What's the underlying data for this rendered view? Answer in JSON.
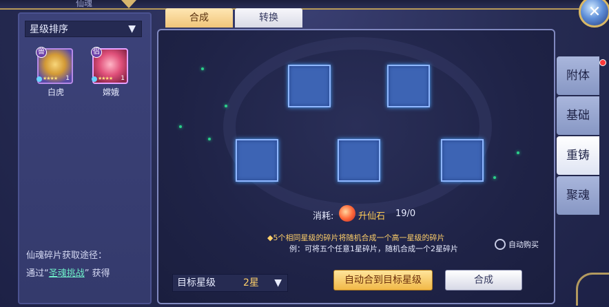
{
  "window": {
    "title": "仙魂"
  },
  "tabs": [
    {
      "label": "合成"
    },
    {
      "label": "转换"
    }
  ],
  "sidebar": {
    "sort_label": "星级排序",
    "heroes": [
      {
        "name": "白虎",
        "tag": "兽",
        "level": "1",
        "stars": "★★★★"
      },
      {
        "name": "嫦娥",
        "tag": "侣",
        "level": "1",
        "stars": "★★★★"
      }
    ],
    "source_title": "仙魂碎片获取途径：",
    "source_prefix": "通过“",
    "source_link": "圣魂挑战",
    "source_suffix": "” 获得"
  },
  "main": {
    "cost_label": "消耗:",
    "cost_item": "升仙石",
    "cost_count": "19/0",
    "tip_line1": "◆5个相同星级的碎片将随机合成一个高一星级的碎片",
    "tip_line2": "例：可将五个任意1星碎片，随机合成一个2星碎片",
    "auto_buy_label": "自动购买",
    "target_label": "目标星级",
    "target_value": "2星",
    "auto_merge_button": "自动合到目标星级",
    "merge_button": "合成"
  },
  "side_tabs": [
    {
      "label": "附体"
    },
    {
      "label": "基础"
    },
    {
      "label": "重铸"
    },
    {
      "label": "聚魂"
    }
  ],
  "colors": {
    "accent_gold": "#f0c57a",
    "slot_blue": "#3d64b4",
    "link_green": "#6ff0c9",
    "notice_red": "#ff3a3a"
  }
}
